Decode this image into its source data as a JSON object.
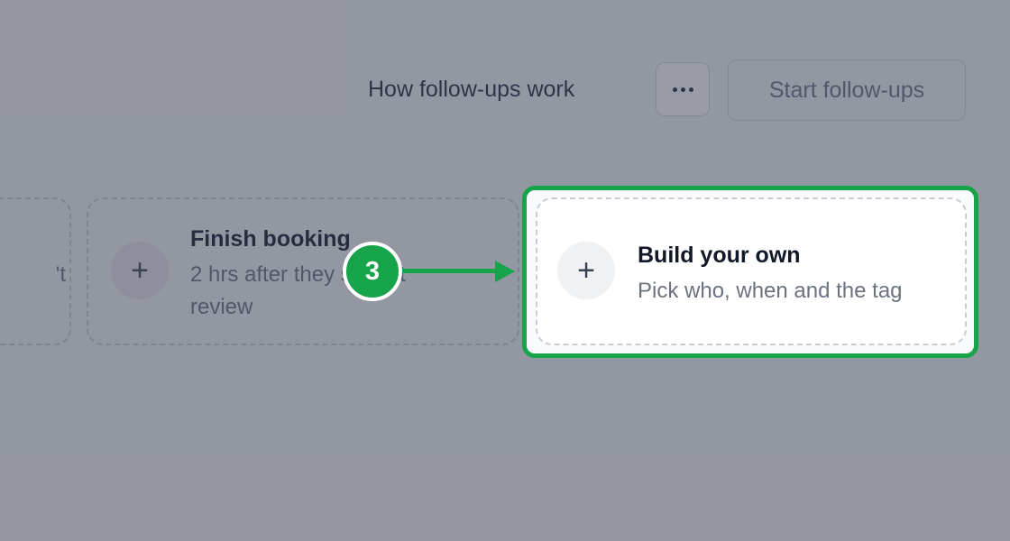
{
  "header": {
    "help_link": "How follow-ups work",
    "more_icon": "ellipsis-icon",
    "start_button": "Start follow-ups"
  },
  "cards": {
    "partial": {
      "peek_text": "'t"
    },
    "finish_booking": {
      "icon": "plus-icon",
      "plus_glyph": "+",
      "title": "Finish booking",
      "description": "2 hrs after they stop at review"
    },
    "build_your_own": {
      "icon": "plus-icon",
      "plus_glyph": "+",
      "title": "Build your own",
      "description": "Pick who, when and the tag"
    }
  },
  "tour": {
    "step_number": "3",
    "accent_color": "#16a34a",
    "overlay_color": "#3c4254"
  }
}
